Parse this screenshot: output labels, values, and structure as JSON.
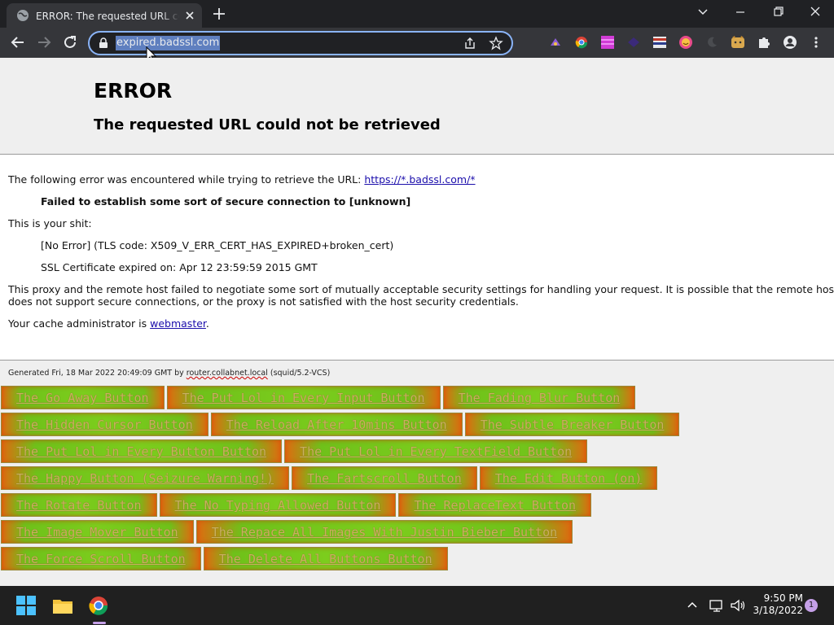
{
  "browser": {
    "tab": {
      "title": "ERROR: The requested URL could not be retrieved",
      "favicon": "globe-icon"
    },
    "url": "expired.badssl.com",
    "extensions": [
      "ext-purple-icon",
      "ext-chrome-icon",
      "ext-pink-grid-icon",
      "ext-dark-icon",
      "ext-stripes-icon",
      "ext-face-icon",
      "ext-moon-icon",
      "ext-doge-icon",
      "puzzle-icon",
      "profile-icon",
      "menu-dots-icon"
    ]
  },
  "error": {
    "title": "ERROR",
    "subtitle": "The requested URL could not be retrieved",
    "intro": "The following error was encountered while trying to retrieve the URL: ",
    "url_link": "https://*.badssl.com/*",
    "failure": "Failed to establish some sort of secure connection to [unknown]",
    "shit_label": "This is your shit:",
    "tls_line": "[No Error] (TLS code: X509_V_ERR_CERT_HAS_EXPIRED+broken_cert)",
    "ssl_line": "SSL Certificate expired on: Apr 12 23:59:59 2015 GMT",
    "proxy_line1": "This proxy and the remote host failed to negotiate some sort of mutually acceptable security settings for handling your request. It is possible that the remote host",
    "proxy_line2": "does not support secure connections, or the proxy is not satisfied with the host security credentials.",
    "cache_prefix": "Your cache administrator is ",
    "cache_link": "webmaster",
    "cache_suffix": "."
  },
  "footer": {
    "gen_prefix": "Generated Fri, 18 Mar 2022 20:49:09 GMT by ",
    "gen_host": "router.collabnet.local",
    "gen_suffix": " (squid/5.2-VCS)"
  },
  "buttons": [
    [
      "The Go Away Button",
      "The Put Lol in Every Input Button",
      "The Fading Blur Button"
    ],
    [
      "The Hidden Cursor Button",
      "The Reload After 10mins Button",
      "The Subtle Breaker Button"
    ],
    [
      "The Put Lol in Every Button Button",
      "The Put Lol in Every TextField Button"
    ],
    [
      "The Happy Button (Seizure Warning!)",
      "The Fartscroll Button",
      "The Edit Button (on)"
    ],
    [
      "The Rotate Button",
      "The No Typing Allowed Button",
      "The ReplaceText Button"
    ],
    [
      "The Image Mover Button",
      "The Repace All Images With Justin Bieber Button"
    ],
    [
      "The Force Scroll Button",
      "The Delete All Buttons Button"
    ]
  ],
  "taskbar": {
    "time": "9:50 PM",
    "date": "3/18/2022",
    "notifications": "1"
  }
}
